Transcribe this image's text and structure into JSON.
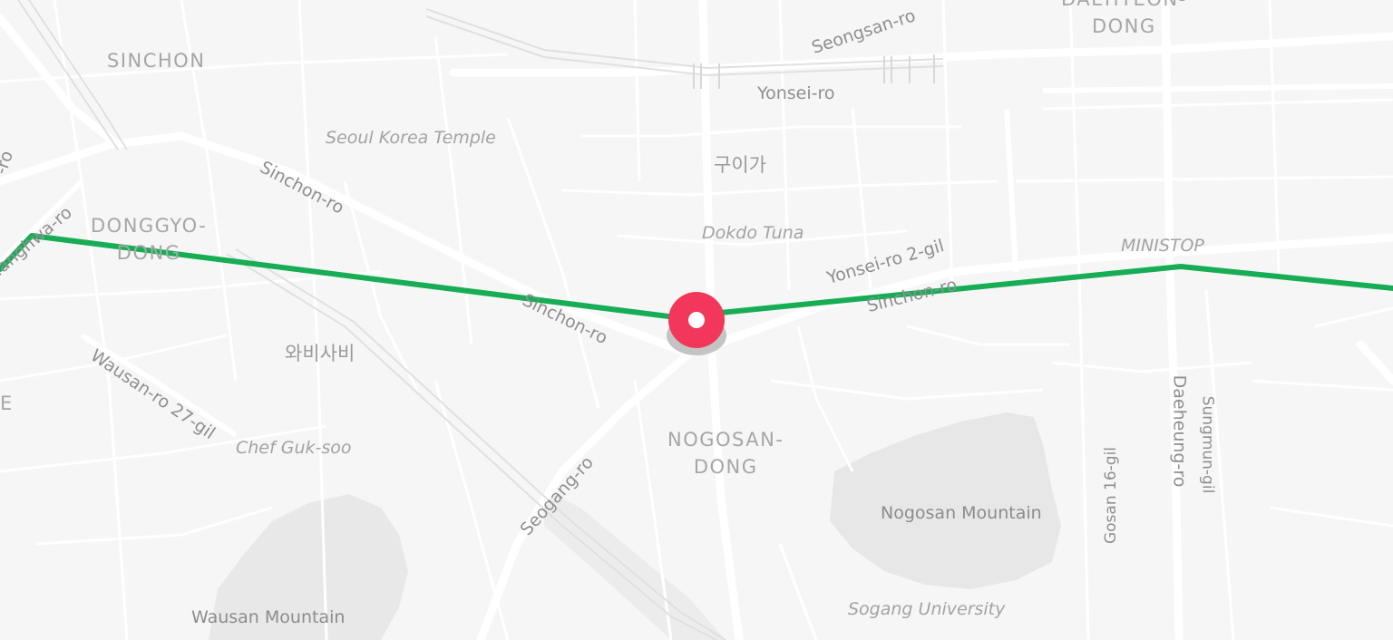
{
  "map": {
    "route_color": "#17ad55",
    "marker_color": "#f2375b",
    "areas": {
      "sinchon": "SINCHON",
      "donggyo_dong": "DONGGYO-\nDONG",
      "nogosan_dong": "NOGOSAN-\nDONG",
      "daehyeon_dong": "DAEHYEON-\nDONG",
      "edge_fragment": "E"
    },
    "roads": {
      "seongsan_ro": "Seongsan-ro",
      "yonsei_ro": "Yonsei-ro",
      "sinchon_ro_upper": "Sinchon-ro",
      "sinchon_ro_mid": "Sinchon-ro",
      "sinchon_ro_right": "Sinchon-ro",
      "yonsei_ro_2_gil": "Yonsei-ro 2-gil",
      "yanghwa_ro": "Yanghwa-ro",
      "edge_road": "-ro",
      "wausan_ro_27_gil": "Wausan-ro 27-gil",
      "seogang_ro": "Seogang-ro",
      "daeheung_ro": "Daeheung-ro",
      "sungmun_gil": "Sungmun-gil",
      "gosan_16_gil": "Gosan 16-gil"
    },
    "pois": {
      "seoul_korea_temple": "Seoul Korea Temple",
      "dokdo_tuna": "Dokdo Tuna",
      "ministop": "MINISTOP",
      "chef_guk_soo": "Chef Guk-soo",
      "sogang_university": "Sogang University",
      "guiga": "구이가",
      "wabisabi": "와비사비"
    },
    "mountains": {
      "nogosan": "Nogosan Mountain",
      "wausan": "Wausan Mountain"
    }
  }
}
